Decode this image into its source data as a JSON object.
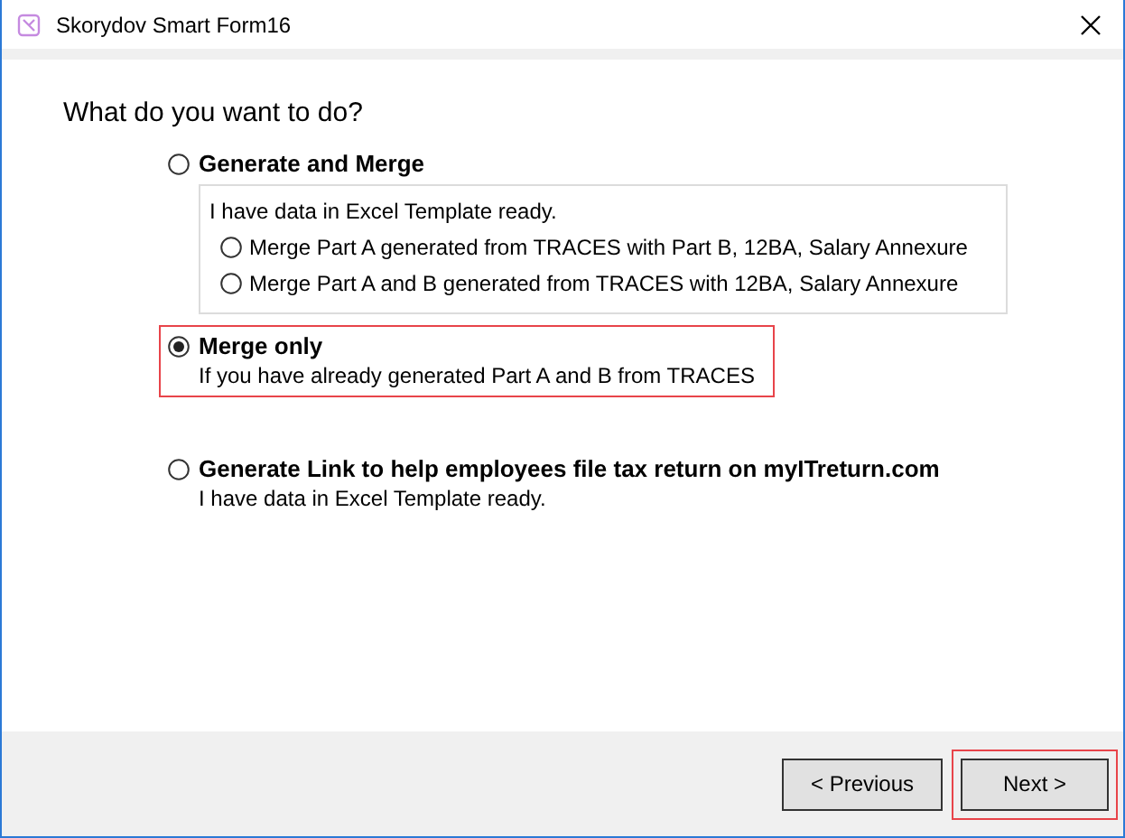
{
  "window": {
    "title": "Skorydov Smart Form16"
  },
  "heading": "What do you want to do?",
  "options": [
    {
      "label": "Generate and Merge",
      "selected": false,
      "highlighted": false,
      "group": {
        "text": "I have data in Excel Template ready.",
        "options": [
          {
            "label": "Merge Part A generated from TRACES with Part B, 12BA, Salary Annexure",
            "selected": false
          },
          {
            "label": "Merge Part A and B generated from TRACES with 12BA, Salary Annexure",
            "selected": false
          }
        ]
      }
    },
    {
      "label": "Merge only",
      "selected": true,
      "highlighted": true,
      "description": "If you have already generated Part A and  B from TRACES"
    },
    {
      "label": "Generate Link to help employees file tax return on myITreturn.com",
      "selected": false,
      "highlighted": false,
      "description": "I have data in Excel Template ready."
    }
  ],
  "buttons": [
    {
      "label": "< Previous",
      "highlighted": false
    },
    {
      "label": "Next >",
      "highlighted": true
    }
  ]
}
